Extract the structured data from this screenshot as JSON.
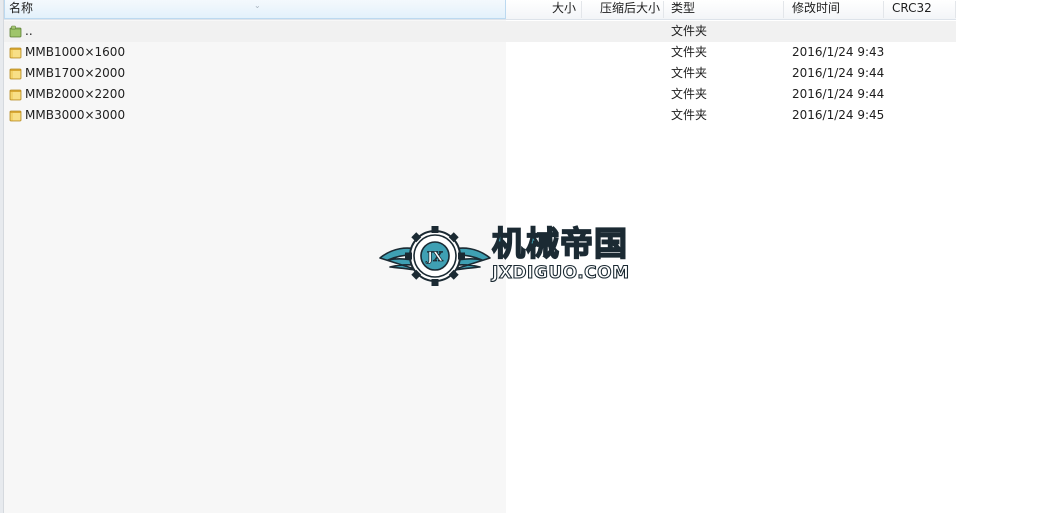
{
  "columns": {
    "name": "名称",
    "size": "大小",
    "packed": "压缩后大小",
    "type": "类型",
    "modified": "修改时间",
    "crc": "CRC32"
  },
  "parent_row": {
    "name": "..",
    "type": "文件夹"
  },
  "rows": [
    {
      "name": "MMB1000×1600",
      "type": "文件夹",
      "modified": "2016/1/24 9:43"
    },
    {
      "name": "MMB1700×2000",
      "type": "文件夹",
      "modified": "2016/1/24 9:44"
    },
    {
      "name": "MMB2000×2200",
      "type": "文件夹",
      "modified": "2016/1/24 9:44"
    },
    {
      "name": "MMB3000×3000",
      "type": "文件夹",
      "modified": "2016/1/24 9:45"
    }
  ],
  "watermark": {
    "emblem_text": "JX",
    "chinese": "机械帝国",
    "english": "JXDIGUO.COM"
  },
  "icons": {
    "parent": "parent-folder-icon",
    "folder": "folder-icon"
  },
  "colors": {
    "folder": "#e8c04a",
    "parent_folder": "#7fa84e",
    "logo_accent": "#3fa0b3",
    "logo_outline": "#1b2a33",
    "header_selected": "#e3f1fb"
  }
}
